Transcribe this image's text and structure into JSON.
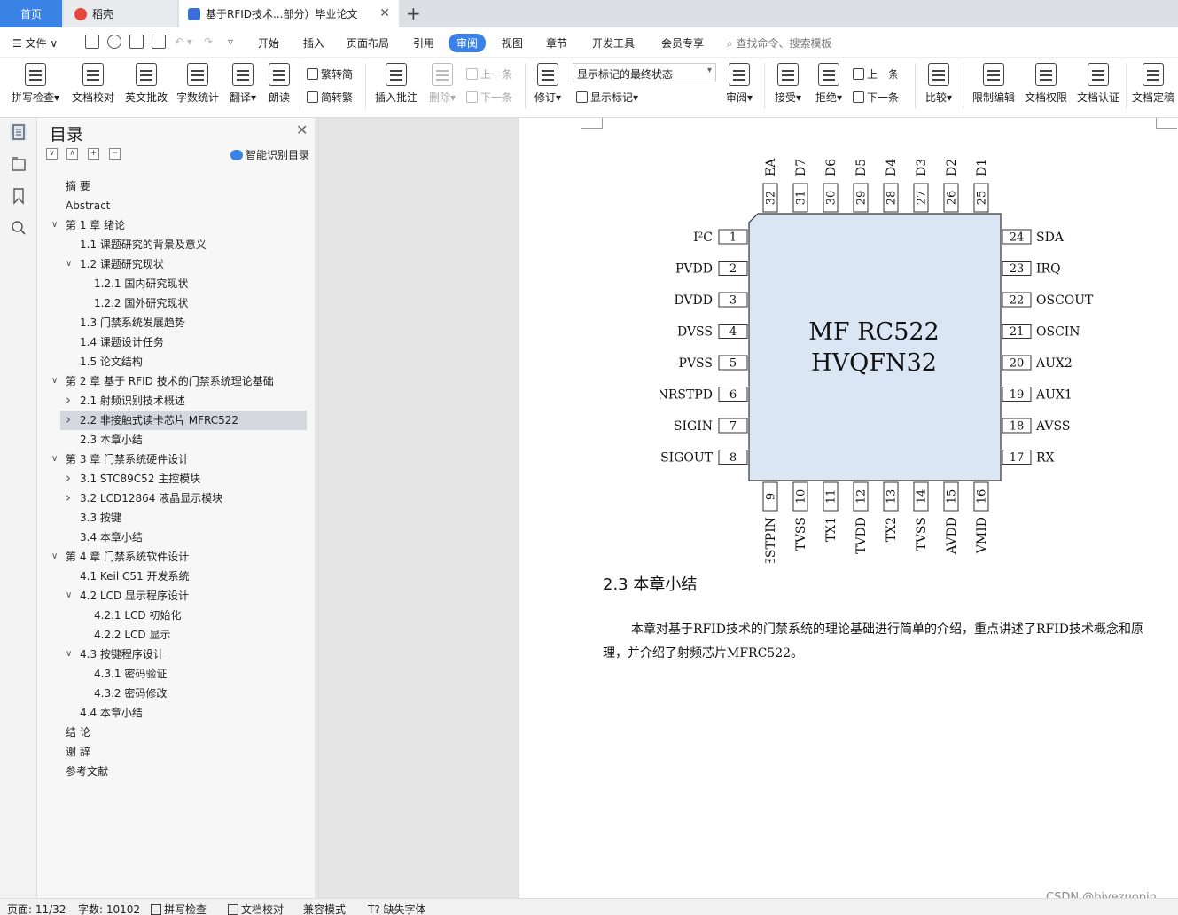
{
  "tabs": {
    "home": "首页",
    "daoke": "稻壳",
    "document": "基于RFID技术...部分）毕业论文"
  },
  "menubar": {
    "file": "文件",
    "items": [
      "开始",
      "插入",
      "页面布局",
      "引用",
      "审阅",
      "视图",
      "章节",
      "开发工具",
      "会员专享"
    ],
    "active": "审阅",
    "search_placeholder": "查找命令、搜索模板"
  },
  "ribbon": {
    "spell_check": "拼写检查",
    "doc_proof": "文档校对",
    "eng_review": "英文批改",
    "word_count": "字数统计",
    "translate": "翻译",
    "read_aloud": "朗读",
    "trad_to_simp": "繁转简",
    "simp_to_trad": "简转繁",
    "insert_comment": "插入批注",
    "delete": "删除",
    "prev_comment": "上一条",
    "next_comment": "下一条",
    "track_changes": "修订",
    "markup_state": "显示标记的最终状态",
    "show_markup": "显示标记",
    "review": "审阅",
    "accept": "接受",
    "reject": "拒绝",
    "prev_change": "上一条",
    "next_change": "下一条",
    "compare": "比较",
    "restrict_edit": "限制编辑",
    "doc_permission": "文档权限",
    "doc_cert": "文档认证",
    "doc_finalize": "文档定稿"
  },
  "toc": {
    "title": "目录",
    "smart_label": "智能识别目录",
    "items": [
      {
        "text": "摘  要",
        "level": 0,
        "arrow": ""
      },
      {
        "text": "Abstract",
        "level": 0,
        "arrow": ""
      },
      {
        "text": "第 1 章  绪论",
        "level": 0,
        "arrow": "down"
      },
      {
        "text": "1.1  课题研究的背景及意义",
        "level": 1,
        "arrow": ""
      },
      {
        "text": "1.2  课题研究现状",
        "level": 1,
        "arrow": "down"
      },
      {
        "text": "1.2.1  国内研究现状",
        "level": 2,
        "arrow": ""
      },
      {
        "text": "1.2.2  国外研究现状",
        "level": 2,
        "arrow": ""
      },
      {
        "text": "1.3  门禁系统发展趋势",
        "level": 1,
        "arrow": ""
      },
      {
        "text": "1.4  课题设计任务",
        "level": 1,
        "arrow": ""
      },
      {
        "text": "1.5  论文结构",
        "level": 1,
        "arrow": ""
      },
      {
        "text": "第 2 章  基于 RFID 技术的门禁系统理论基础",
        "level": 0,
        "arrow": "down"
      },
      {
        "text": "2.1  射频识别技术概述",
        "level": 1,
        "arrow": "right"
      },
      {
        "text": "2.2  非接触式读卡芯片 MFRC522",
        "level": 1,
        "arrow": "right",
        "selected": true
      },
      {
        "text": "2.3  本章小结",
        "level": 1,
        "arrow": ""
      },
      {
        "text": "第 3 章  门禁系统硬件设计",
        "level": 0,
        "arrow": "down"
      },
      {
        "text": "3.1 STC89C52 主控模块",
        "level": 1,
        "arrow": "right"
      },
      {
        "text": "3.2 LCD12864 液晶显示模块",
        "level": 1,
        "arrow": "right"
      },
      {
        "text": "3.3  按键",
        "level": 1,
        "arrow": ""
      },
      {
        "text": "3.4  本章小结",
        "level": 1,
        "arrow": ""
      },
      {
        "text": "第 4 章  门禁系统软件设计",
        "level": 0,
        "arrow": "down"
      },
      {
        "text": "4.1 Keil  C51 开发系统",
        "level": 1,
        "arrow": ""
      },
      {
        "text": "4.2 LCD 显示程序设计",
        "level": 1,
        "arrow": "down"
      },
      {
        "text": "4.2.1 LCD 初始化",
        "level": 2,
        "arrow": ""
      },
      {
        "text": "4.2.2 LCD 显示",
        "level": 2,
        "arrow": ""
      },
      {
        "text": "4.3 按键程序设计",
        "level": 1,
        "arrow": "down"
      },
      {
        "text": "4.3.1  密码验证",
        "level": 2,
        "arrow": ""
      },
      {
        "text": "4.3.2  密码修改",
        "level": 2,
        "arrow": ""
      },
      {
        "text": "4.4 本章小结",
        "level": 1,
        "arrow": ""
      },
      {
        "text": "结  论",
        "level": 0,
        "arrow": ""
      },
      {
        "text": "谢  辞",
        "level": 0,
        "arrow": ""
      },
      {
        "text": "参考文献",
        "level": 0,
        "arrow": ""
      }
    ]
  },
  "chip": {
    "name_line1": "MF RC522",
    "name_line2": "HVQFN32",
    "top_pins": [
      {
        "num": "32",
        "label": "EA"
      },
      {
        "num": "31",
        "label": "D7"
      },
      {
        "num": "30",
        "label": "D6"
      },
      {
        "num": "29",
        "label": "D5"
      },
      {
        "num": "28",
        "label": "D4"
      },
      {
        "num": "27",
        "label": "D3"
      },
      {
        "num": "26",
        "label": "D2"
      },
      {
        "num": "25",
        "label": "D1"
      }
    ],
    "left_pins": [
      {
        "num": "1",
        "label": "I²C"
      },
      {
        "num": "2",
        "label": "PVDD"
      },
      {
        "num": "3",
        "label": "DVDD"
      },
      {
        "num": "4",
        "label": "DVSS"
      },
      {
        "num": "5",
        "label": "PVSS"
      },
      {
        "num": "6",
        "label": "NRSTPD"
      },
      {
        "num": "7",
        "label": "SIGIN"
      },
      {
        "num": "8",
        "label": "SIGOUT"
      }
    ],
    "right_pins": [
      {
        "num": "24",
        "label": "SDA"
      },
      {
        "num": "23",
        "label": "IRQ"
      },
      {
        "num": "22",
        "label": "OSCOUT"
      },
      {
        "num": "21",
        "label": "OSCIN"
      },
      {
        "num": "20",
        "label": "AUX2"
      },
      {
        "num": "19",
        "label": "AUX1"
      },
      {
        "num": "18",
        "label": "AVSS"
      },
      {
        "num": "17",
        "label": "RX"
      }
    ],
    "bottom_pins": [
      {
        "num": "9",
        "label": "ESTPIN"
      },
      {
        "num": "10",
        "label": "TVSS"
      },
      {
        "num": "11",
        "label": "TX1"
      },
      {
        "num": "12",
        "label": "TVDD"
      },
      {
        "num": "13",
        "label": "TX2"
      },
      {
        "num": "14",
        "label": "TVSS"
      },
      {
        "num": "15",
        "label": "AVDD"
      },
      {
        "num": "16",
        "label": "VMID"
      }
    ]
  },
  "document": {
    "section_heading": "2.3  本章小结",
    "section_body": "本章对基于RFID技术的门禁系统的理论基础进行简单的介绍，重点讲述了RFID技术概念和原理，并介绍了射频芯片MFRC522。"
  },
  "watermark": "CSDN @biyezuopin",
  "statusbar": {
    "page": "页面: 11/32",
    "words": "字数: 10102",
    "spell_check": "拼写检查",
    "doc_proof": "文档校对",
    "compat_mode": "兼容模式",
    "missing_font": "缺失字体"
  }
}
